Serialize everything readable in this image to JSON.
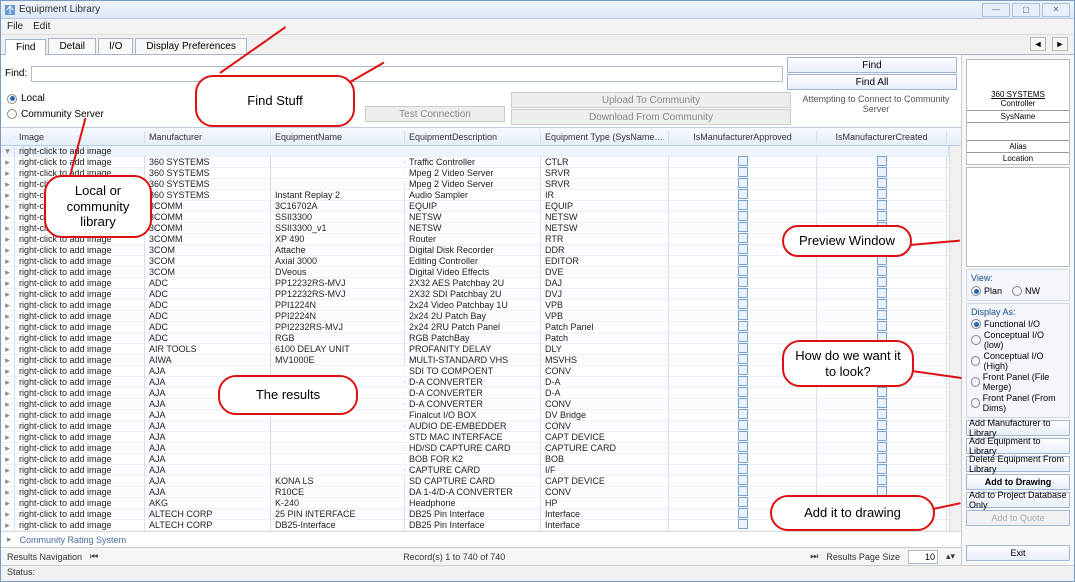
{
  "window": {
    "title": "Equipment Library"
  },
  "menu": {
    "file": "File",
    "edit": "Edit"
  },
  "tabs": {
    "find": "Find",
    "detail": "Detail",
    "io": "I/O",
    "display": "Display Preferences"
  },
  "find": {
    "label": "Find:",
    "value": "",
    "local": "Local",
    "community": "Community Server",
    "test_conn": "Test Connection",
    "upload": "Upload To Community",
    "download": "Download From Community",
    "find_btn": "Find",
    "find_all_btn": "Find All",
    "attempting": "Attempting to Connect to Community Server"
  },
  "columns": {
    "image": "Image",
    "manufacturer": "Manufacturer",
    "name": "EquipmentName",
    "desc": "EquipmentDescription",
    "type": "Equipment Type (SysName Prefix)",
    "approved": "IsManufacturerApproved",
    "created": "IsManufacturerCreated"
  },
  "group_row": "right-click to add image",
  "rows": [
    {
      "img": "right-click to add image",
      "mfr": "360 SYSTEMS",
      "name": "",
      "desc": "Traffic Controller",
      "type": "CTLR"
    },
    {
      "img": "right-click to add image",
      "mfr": "360 SYSTEMS",
      "name": "",
      "desc": "Mpeg 2 Video Server",
      "type": "SRVR"
    },
    {
      "img": "right-click to add image",
      "mfr": "360 SYSTEMS",
      "name": "",
      "desc": "Mpeg 2 Video Server",
      "type": "SRVR"
    },
    {
      "img": "right-click to add image",
      "mfr": "360 SYSTEMS",
      "name": "Instant Replay 2",
      "desc": "Audio Sampler",
      "type": "IR"
    },
    {
      "img": "right-click to add image",
      "mfr": "3COMM",
      "name": "3C16702A",
      "desc": "EQUIP",
      "type": "EQUIP"
    },
    {
      "img": "right-click to add image",
      "mfr": "3COMM",
      "name": "SSII3300",
      "desc": "NETSW",
      "type": "NETSW"
    },
    {
      "img": "right-click to add image",
      "mfr": "3COMM",
      "name": "SSII3300_v1",
      "desc": "NETSW",
      "type": "NETSW"
    },
    {
      "img": "right-click to add image",
      "mfr": "3COMM",
      "name": "XP 490",
      "desc": "Router",
      "type": "RTR"
    },
    {
      "img": "right-click to add image",
      "mfr": "3COM",
      "name": "Attache",
      "desc": "Digital Disk Recorder",
      "type": "DDR"
    },
    {
      "img": "right-click to add image",
      "mfr": "3COM",
      "name": "Axial 3000",
      "desc": "Editing Controller",
      "type": "EDITOR"
    },
    {
      "img": "right-click to add image",
      "mfr": "3COM",
      "name": "DVeous",
      "desc": "Digital Video Effects",
      "type": "DVE"
    },
    {
      "img": "right-click to add image",
      "mfr": "ADC",
      "name": "PP12232RS-MVJ",
      "desc": "2X32 AES Patchbay 2U",
      "type": "DAJ"
    },
    {
      "img": "right-click to add image",
      "mfr": "ADC",
      "name": "PP12232RS-MVJ",
      "desc": "2X32 SDI Patchbay 2U",
      "type": "DVJ"
    },
    {
      "img": "right-click to add image",
      "mfr": "ADC",
      "name": "PPI1224N",
      "desc": "2x24 Video Patchbay 1U",
      "type": "VPB"
    },
    {
      "img": "right-click to add image",
      "mfr": "ADC",
      "name": "PPI2224N",
      "desc": "2x24 2U Patch Bay",
      "type": "VPB"
    },
    {
      "img": "right-click to add image",
      "mfr": "ADC",
      "name": "PPI2232RS-MVJ",
      "desc": "2x24 2RU Patch Panel",
      "type": "Patch Panel"
    },
    {
      "img": "right-click to add image",
      "mfr": "ADC",
      "name": "RGB",
      "desc": "RGB PatchBay",
      "type": "Patch"
    },
    {
      "img": "right-click to add image",
      "mfr": "AIR TOOLS",
      "name": "6100 DELAY UNIT",
      "desc": "PROFANITY DELAY",
      "type": "DLY"
    },
    {
      "img": "right-click to add image",
      "mfr": "AIWA",
      "name": "MV1000E",
      "desc": "MULTI-STANDARD VHS",
      "type": "MSVHS"
    },
    {
      "img": "right-click to add image",
      "mfr": "AJA",
      "name": "",
      "desc": "SDI TO COMPOENT",
      "type": "CONV"
    },
    {
      "img": "right-click to add image",
      "mfr": "AJA",
      "name": "",
      "desc": "D-A CONVERTER",
      "type": "D-A"
    },
    {
      "img": "right-click to add image",
      "mfr": "AJA",
      "name": "",
      "desc": "D-A CONVERTER",
      "type": "D-A"
    },
    {
      "img": "right-click to add image",
      "mfr": "AJA",
      "name": "",
      "desc": "D-A CONVERTER",
      "type": "CONV"
    },
    {
      "img": "right-click to add image",
      "mfr": "AJA",
      "name": "",
      "desc": "Finalcut I/O BOX",
      "type": "DV Bridge"
    },
    {
      "img": "right-click to add image",
      "mfr": "AJA",
      "name": "",
      "desc": "AUDIO DE-EMBEDDER",
      "type": "CONV"
    },
    {
      "img": "right-click to add image",
      "mfr": "AJA",
      "name": "",
      "desc": "STD MAC INTERFACE",
      "type": "CAPT DEVICE"
    },
    {
      "img": "right-click to add image",
      "mfr": "AJA",
      "name": "",
      "desc": "HD/SD CAPTURE CARD",
      "type": "CAPTURE CARD"
    },
    {
      "img": "right-click to add image",
      "mfr": "AJA",
      "name": "",
      "desc": "BOB FOR K2",
      "type": "BOB"
    },
    {
      "img": "right-click to add image",
      "mfr": "AJA",
      "name": "",
      "desc": "CAPTURE CARD",
      "type": "I/F"
    },
    {
      "img": "right-click to add image",
      "mfr": "AJA",
      "name": "KONA LS",
      "desc": "SD CAPTURE CARD",
      "type": "CAPT DEVICE"
    },
    {
      "img": "right-click to add image",
      "mfr": "AJA",
      "name": "R10CE",
      "desc": "DA 1-4/D-A CONVERTER",
      "type": "CONV"
    },
    {
      "img": "right-click to add image",
      "mfr": "AKG",
      "name": "K-240",
      "desc": "Headphone",
      "type": "HP"
    },
    {
      "img": "right-click to add image",
      "mfr": "ALTECH CORP",
      "name": "25 PIN INTERFACE",
      "desc": "DB25 Pin Interface",
      "type": "Interface"
    },
    {
      "img": "right-click to add image",
      "mfr": "ALTECH CORP",
      "name": "DB25-Interface",
      "desc": "DB25 Pin Interface",
      "type": "Interface"
    }
  ],
  "community_rating": "Community Rating System",
  "nav": {
    "label": "Results Navigation",
    "records": "Record(s) 1 to 740 of 740",
    "page_size_label": "Results Page Size",
    "page_size": "10"
  },
  "status": "Status:",
  "preview": {
    "brand": "360 SYSTEMS",
    "ctrl": "Controller",
    "sysname": "SysName",
    "alias": "Alias",
    "location": "Location"
  },
  "right": {
    "view": "View:",
    "plan": "Plan",
    "nw": "NW",
    "display_as": "Display As:",
    "d1": "Functional I/O",
    "d2": "Conceptual I/O (low)",
    "d3": "Conceptual I/O (High)",
    "d4": "Front Panel (File Merge)",
    "d5": "Front Panel (From Dims)",
    "b1": "Add Manufacturer to Library",
    "b2": "Add Equipment to Library",
    "b3": "Delete Equipment From Library",
    "b4": "Add to Drawing",
    "b5": "Add to Project Database Only",
    "b6": "Add to Quote",
    "exit": "Exit"
  },
  "annotations": {
    "a1": "Find Stuff",
    "a2": "Local or community library",
    "a3": "The results",
    "a4": "Preview Window",
    "a5": "How do we want it to look?",
    "a6": "Add it to drawing"
  }
}
